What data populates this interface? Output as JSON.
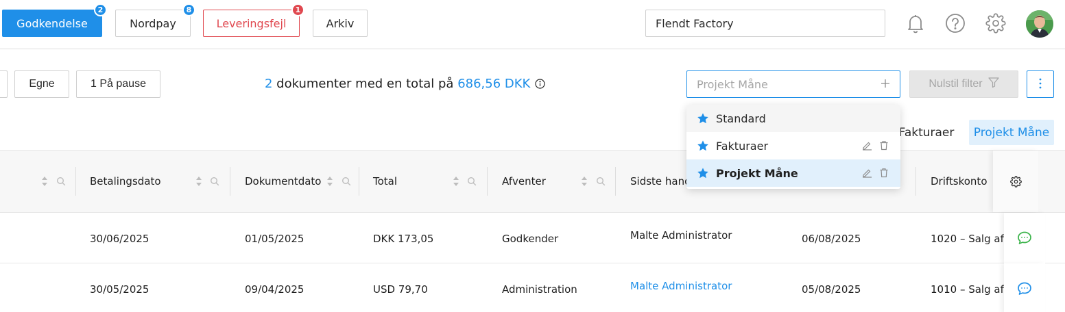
{
  "tabs": [
    {
      "label": "Godkendelse",
      "badge": "2"
    },
    {
      "label": "Nordpay",
      "badge": "8"
    },
    {
      "label": "Leveringsfejl",
      "badge": "1"
    },
    {
      "label": "Arkiv"
    }
  ],
  "company": {
    "value": "Flendt Factory"
  },
  "icons": {
    "bell": "bell-icon",
    "help": "help-icon",
    "settings": "gear-icon"
  },
  "filters": {
    "egne_label": "Egne",
    "paused_label": "1 På pause"
  },
  "summary": {
    "count": "2",
    "text_middle": " dokumenter med en total på ",
    "total": "686,56 DKK"
  },
  "view_input": {
    "placeholder": "Projekt Måne"
  },
  "reset_label": "Nulstil filter",
  "view_tabs": [
    "Fakturaer",
    "Projekt Måne"
  ],
  "dropdown": {
    "items": [
      {
        "label": "Standard"
      },
      {
        "label": "Fakturaer"
      },
      {
        "label": "Projekt Måne"
      }
    ]
  },
  "columns": {
    "betalingsdato": "Betalingsdato",
    "dokumentdato": "Dokumentdato",
    "total": "Total",
    "afventer": "Afventer",
    "sidste": "Sidste hand",
    "driftskonto": "Driftskonto"
  },
  "rows": [
    {
      "betalingsdato": "30/06/2025",
      "dokumentdato": "01/05/2025",
      "total": "DKK 173,05",
      "afventer": "Godkender",
      "sidste": "Malte Administrator",
      "dato": "06/08/2025",
      "driftskonto": "1020 – Salg af"
    },
    {
      "betalingsdato": "30/05/2025",
      "dokumentdato": "09/04/2025",
      "total": "USD 79,70",
      "afventer": "Administration",
      "sidste": "Malte Administrator",
      "dato": "05/08/2025",
      "driftskonto": "1010 – Salg af"
    }
  ],
  "colors": {
    "accent": "#1f8fe8",
    "error": "#e0484f",
    "chat_green": "#3bb34a"
  }
}
